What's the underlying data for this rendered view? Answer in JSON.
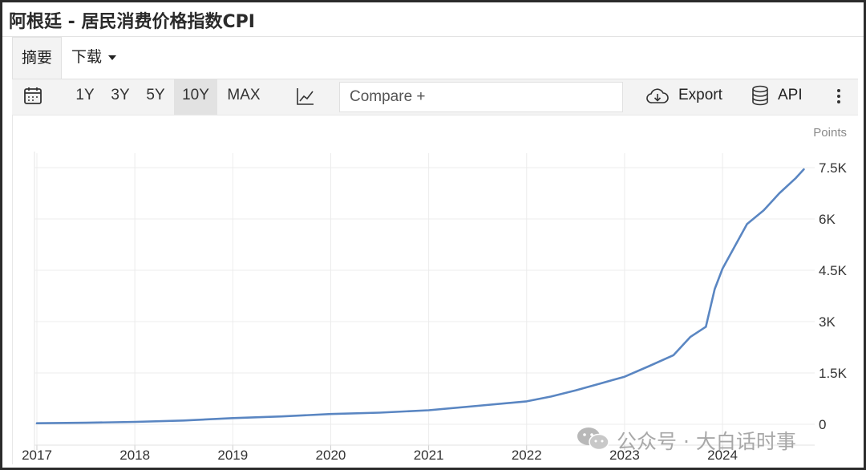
{
  "window": {
    "title": "阿根廷 - 居民消费价格指数CPI"
  },
  "tabs": [
    {
      "label": "摘要"
    },
    {
      "label": "下载"
    }
  ],
  "toolbar": {
    "ranges": [
      "1Y",
      "3Y",
      "5Y",
      "10Y",
      "MAX"
    ],
    "selected_range": "10Y",
    "compare_placeholder": "Compare +",
    "export_label": "Export",
    "api_label": "API"
  },
  "icons": {
    "calendar": "calendar-icon",
    "chart_type": "line-chart-icon",
    "export": "cloud-download-icon",
    "api": "database-icon",
    "more": "more-vertical-icon",
    "watermark": "wechat-icon"
  },
  "watermark": {
    "text": "公众号 · 大白话时事"
  },
  "colors": {
    "line": "#5a86c2",
    "accent_bg": "#f3f3f3"
  },
  "chart_data": {
    "type": "line",
    "title": "",
    "unit_label": "Points",
    "xlabel": "",
    "ylabel": "",
    "x_ticks": [
      "2017",
      "2018",
      "2019",
      "2020",
      "2021",
      "2022",
      "2023",
      "2024"
    ],
    "y_ticks": [
      {
        "value": 0,
        "label": "0"
      },
      {
        "value": 1500,
        "label": "1.5K"
      },
      {
        "value": 3000,
        "label": "3K"
      },
      {
        "value": 4500,
        "label": "4.5K"
      },
      {
        "value": 6000,
        "label": "6K"
      },
      {
        "value": 7500,
        "label": "7.5K"
      }
    ],
    "ylim": [
      0,
      7500
    ],
    "grid": true,
    "series": [
      {
        "x": [
          2017.0,
          2017.5,
          2018.0,
          2018.5,
          2019.0,
          2019.5,
          2020.0,
          2020.5,
          2021.0,
          2021.5,
          2022.0,
          2022.25,
          2022.5,
          2022.75,
          2023.0,
          2023.25,
          2023.5,
          2023.67,
          2023.83,
          2023.92,
          2024.0,
          2024.25,
          2024.42,
          2024.58,
          2024.75,
          2024.83
        ],
        "y": [
          30,
          45,
          70,
          110,
          180,
          230,
          300,
          340,
          410,
          540,
          670,
          810,
          990,
          1190,
          1390,
          1700,
          2020,
          2550,
          2850,
          3950,
          4550,
          5850,
          6250,
          6750,
          7200,
          7450
        ]
      }
    ]
  }
}
